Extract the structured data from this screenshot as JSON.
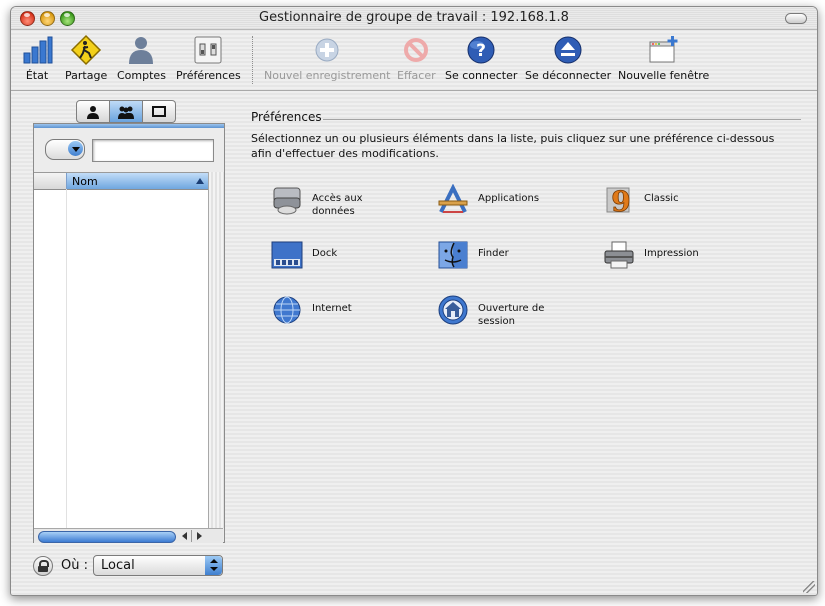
{
  "window": {
    "title": "Gestionnaire de groupe de travail : 192.168.1.8"
  },
  "toolbar": {
    "items": [
      {
        "label": "État",
        "icon": "status-bars-icon"
      },
      {
        "label": "Partage",
        "icon": "sharing-sign-icon"
      },
      {
        "label": "Comptes",
        "icon": "accounts-user-icon"
      },
      {
        "label": "Préférences",
        "icon": "preferences-switch-icon"
      },
      {
        "label": "Nouvel enregistrement",
        "icon": "add-record-icon",
        "disabled": true
      },
      {
        "label": "Effacer",
        "icon": "delete-icon",
        "disabled": true
      },
      {
        "label": "Se connecter",
        "icon": "connect-globe-icon"
      },
      {
        "label": "Se déconnecter",
        "icon": "disconnect-eject-icon"
      },
      {
        "label": "Nouvelle fenêtre",
        "icon": "new-window-icon"
      }
    ]
  },
  "sidebar": {
    "tabs": [
      "user",
      "group",
      "computer"
    ],
    "active_tab": "group",
    "search_value": "",
    "list_header": "Nom",
    "where_label": "Où :",
    "where_value": "Local"
  },
  "main": {
    "title": "Préférences",
    "description": "Sélectionnez un ou plusieurs éléments dans la liste, puis cliquez sur une préférence ci-dessous afin d'effectuer des modifications.",
    "prefs": [
      {
        "label": "Accès aux données",
        "icon": "disk-drive-icon"
      },
      {
        "label": "Applications",
        "icon": "applications-icon"
      },
      {
        "label": "Classic",
        "icon": "classic-nine-icon"
      },
      {
        "label": "Dock",
        "icon": "dock-icon"
      },
      {
        "label": "Finder",
        "icon": "finder-icon"
      },
      {
        "label": "Impression",
        "icon": "printer-icon"
      },
      {
        "label": "Internet",
        "icon": "internet-globe-icon"
      },
      {
        "label": "Ouverture de session",
        "icon": "login-house-icon"
      }
    ]
  },
  "colors": {
    "aqua_blue": "#3f7fcf",
    "window_stripe": "#efefef"
  }
}
